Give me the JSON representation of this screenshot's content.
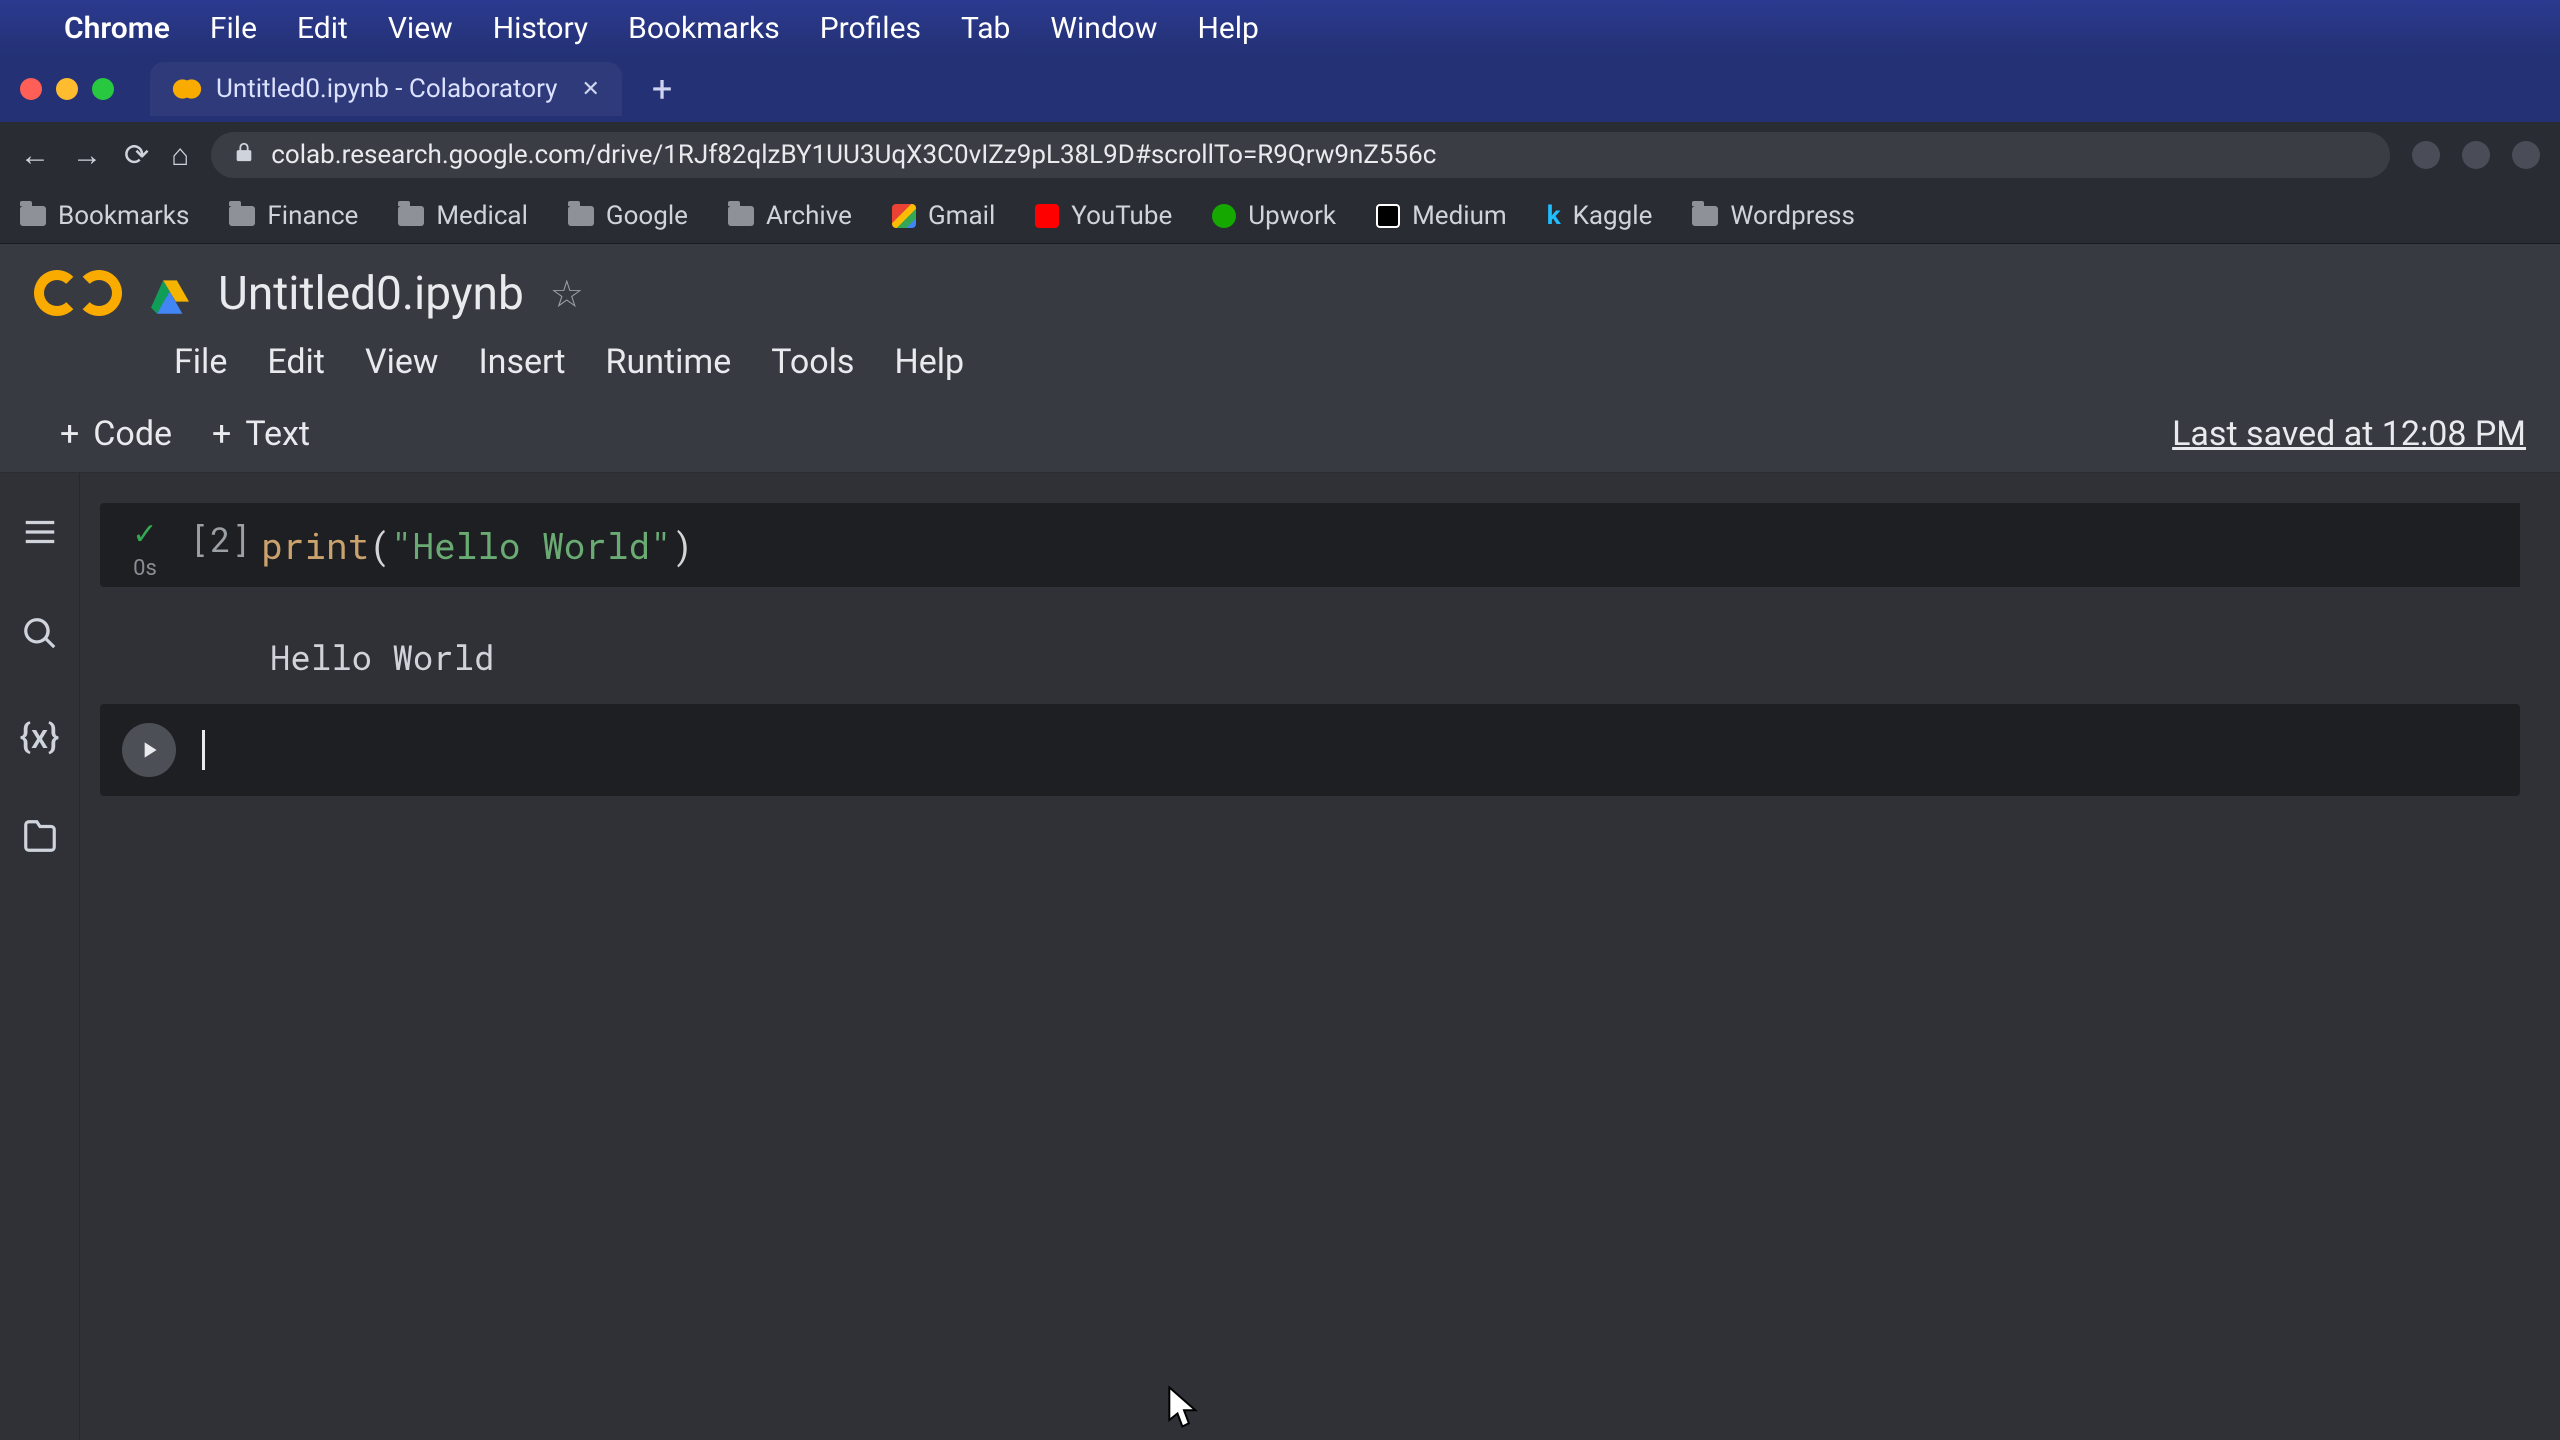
{
  "mac_menu": {
    "app": "Chrome",
    "items": [
      "File",
      "Edit",
      "View",
      "History",
      "Bookmarks",
      "Profiles",
      "Tab",
      "Window",
      "Help"
    ]
  },
  "browser": {
    "tab_title": "Untitled0.ipynb - Colaboratory",
    "url": "colab.research.google.com/drive/1RJf82qlzBY1UU3UqX3C0vIZz9pL38L9D#scrollTo=R9Qrw9nZ556c"
  },
  "bookmarks": [
    "Bookmarks",
    "Finance",
    "Medical",
    "Google",
    "Archive",
    "Gmail",
    "YouTube",
    "Upwork",
    "Medium",
    "Kaggle",
    "Wordpress"
  ],
  "colab": {
    "title": "Untitled0.ipynb",
    "menus": [
      "File",
      "Edit",
      "View",
      "Insert",
      "Runtime",
      "Tools",
      "Help"
    ],
    "toolbar": {
      "code": "Code",
      "text": "Text"
    },
    "last_saved": "Last saved at 12:08 PM"
  },
  "cell1": {
    "exec_count": "[2]",
    "exec_time": "0s",
    "code_fn": "print",
    "code_open": "(",
    "code_str": "\"Hello World\"",
    "code_close": ")",
    "output": "Hello World"
  }
}
